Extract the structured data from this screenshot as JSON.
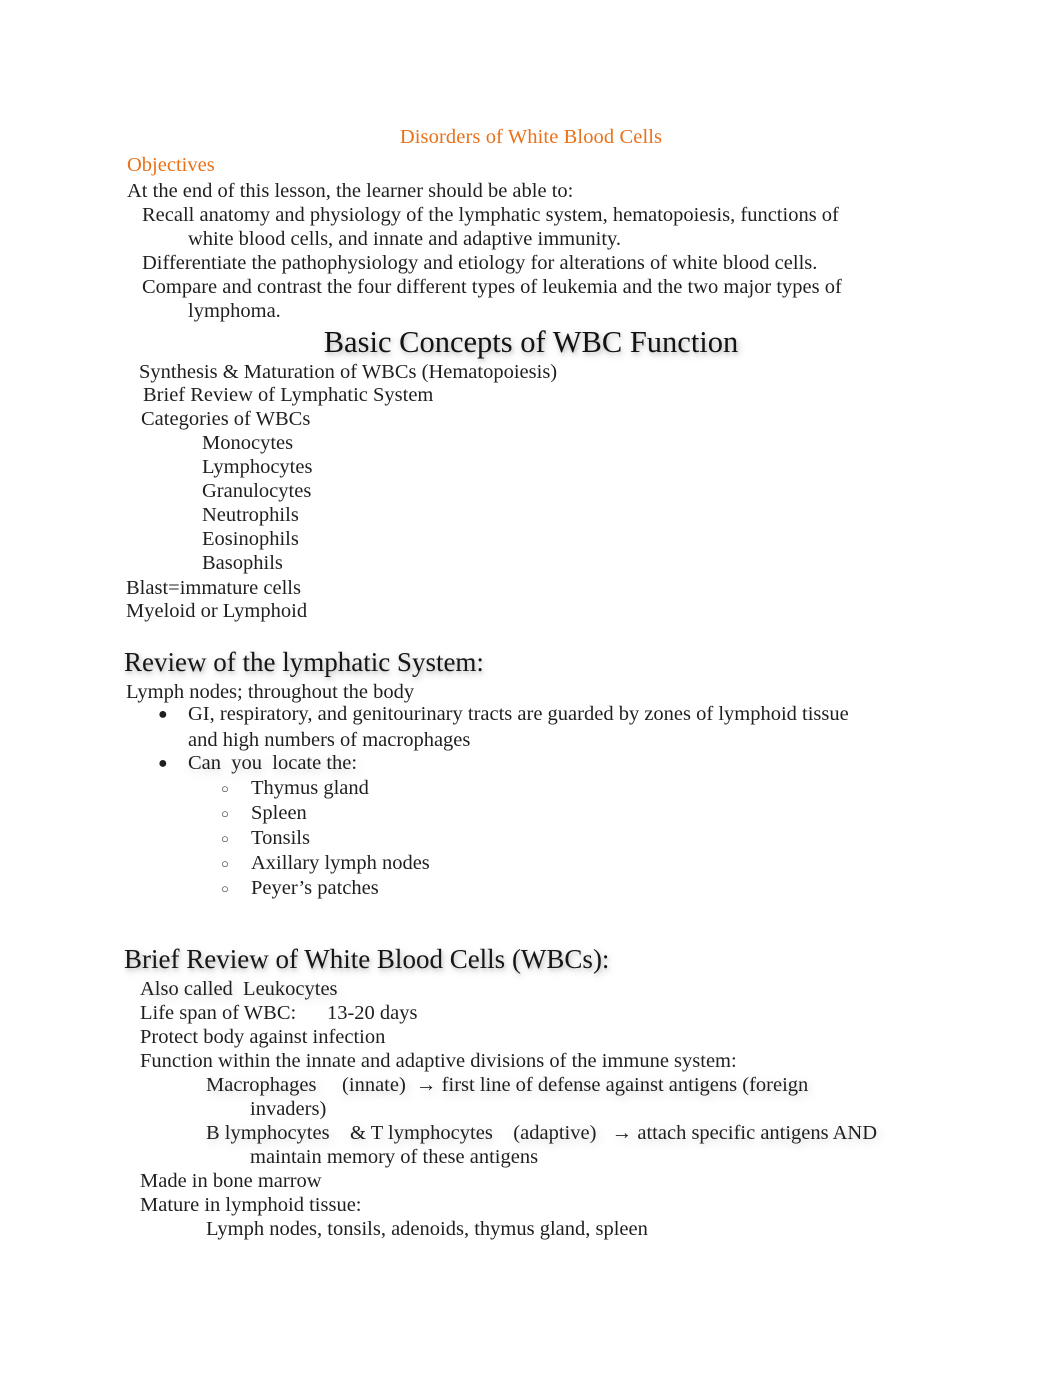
{
  "document": {
    "title": "Disorders of White Blood Cells",
    "accent_color": "#e8711a",
    "text_color": "#1f1f1f",
    "background_color": "#ffffff"
  },
  "objectives": {
    "heading": "Objectives",
    "lead_in": "At the end of this lesson, the learner should be able to:",
    "items": [
      {
        "line1": "Recall anatomy and physiology of the lymphatic system, hematopoiesis, functions of",
        "line2": "white blood cells, and innate and adaptive immunity."
      },
      {
        "line1": "Differentiate the pathophysiology and etiology for alterations of white blood cells.",
        "line2": ""
      },
      {
        "line1": "Compare and contrast the four different types of leukemia and the two major types of",
        "line2": "lymphoma."
      }
    ]
  },
  "basic_concepts": {
    "heading": "Basic Concepts of WBC Function",
    "topics": [
      "Synthesis & Maturation of WBCs (Hematopoiesis)",
      "Brief Review of Lymphatic System",
      "Categories of WBCs"
    ],
    "wbc_categories": [
      "Monocytes",
      "Lymphocytes",
      "Granulocytes",
      "Neutrophils",
      "Eosinophils",
      "Basophils"
    ],
    "notes": [
      "Blast=immature cells",
      "Myeloid or Lymphoid"
    ]
  },
  "lymphatic_review": {
    "heading": "Review of the lymphatic System:",
    "intro": "Lymph nodes; throughout the body",
    "bullets": [
      {
        "marker": "filled-bullet",
        "line1": "GI, respiratory, and genitourinary tracts are guarded by zones of lymphoid tissue",
        "line2": "and high numbers of macrophages"
      },
      {
        "marker": "filled-bullet",
        "line1": "Can  you  locate the:",
        "line2": ""
      }
    ],
    "sub_bullets": [
      "Thymus gland",
      "Spleen",
      "Tonsils",
      "Axillary lymph nodes",
      "Peyer’s patches"
    ]
  },
  "wbc_review": {
    "heading": "Brief Review of White Blood Cells (WBCs):",
    "facts": [
      "Also called  Leukocytes",
      "Life span of WBC:      13-20 days",
      "Protect body against infection",
      "Function within the innate and adaptive divisions of the immune system:"
    ],
    "immune_detail": [
      {
        "line1": "Macrophages     (innate)  → first line of defense against antigens (foreign",
        "line2": "invaders)"
      },
      {
        "line1": "B lymphocytes    & T lymphocytes    (adaptive)   → attach specific antigens AND",
        "line2": "maintain memory of these antigens"
      }
    ],
    "origin": [
      "Made in bone marrow",
      "Mature in lymphoid tissue:"
    ],
    "lymphoid_tissues": "Lymph nodes, tonsils, adenoids, thymus gland, spleen"
  },
  "icons": {
    "filled_bullet": "●",
    "hollow_bullet": "○",
    "arrow": "→"
  }
}
